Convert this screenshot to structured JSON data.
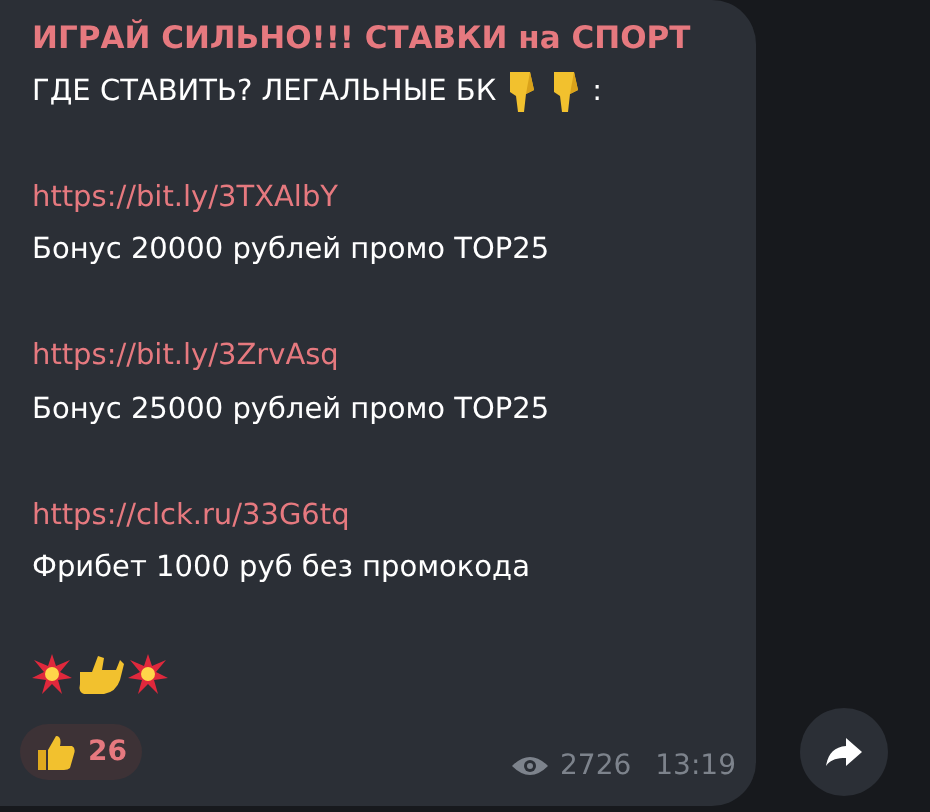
{
  "message": {
    "title": "ИГРАЙ СИЛЬНО!!! СТАВКИ на СПОРТ",
    "subtitle": "ГДЕ СТАВИТЬ? ЛЕГАЛЬНЫЕ БК",
    "subtitle_end": ":",
    "offers": [
      {
        "link": "https://bit.ly/3TXAlbY",
        "text": "Бонус 20000 рублей промо TOP25"
      },
      {
        "link": "https://bit.ly/3ZrvAsq",
        "text": "Бонус 25000 рублей промо TOP25"
      },
      {
        "link": "https://clck.ru/33G6tq",
        "text": "Фрибет 1000 руб без промокода"
      }
    ],
    "reaction": {
      "count": "26"
    },
    "views": "2726",
    "time": "13:19"
  }
}
